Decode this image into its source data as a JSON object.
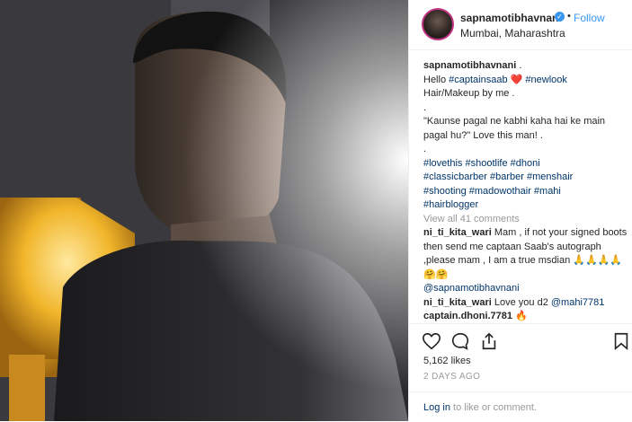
{
  "post": {
    "username": "sapnamotibhavnani",
    "dot": "•",
    "follow_label": "Follow",
    "location": "Mumbai, Maharashtra"
  },
  "caption": {
    "author": "sapnamotibhavnani",
    "author_suffix": " .",
    "line1_prefix": "Hello ",
    "tag_captainsaab": "#captainsaab",
    "heart": "❤️",
    "tag_newlook": "#newlook",
    "line2": "Hair/Makeup by me .",
    "line3": ".",
    "line4": "\"Kaunse pagal ne kabhi kaha hai ke main pagal hu?\" Love this man! .",
    "line5": ".",
    "tags1": "#lovethis #shootlife #dhoni",
    "tags2": "#classicbarber #barber #menshair",
    "tags3": "#shooting #madowothair #mahi",
    "tags4": "#hairblogger"
  },
  "view_all": "View all 41 comments",
  "comments": [
    {
      "user": "ni_ti_kita_wari",
      "text": " Mam , if not your signed boots then send me captaan Saab's autograph ,please mam , I am a true msdian 🙏🙏🙏🙏🤗🤗",
      "mention": "@sapnamotibhavnani"
    },
    {
      "user": "ni_ti_kita_wari",
      "text": " Love you d2 ",
      "mention": "@mahi7781"
    },
    {
      "user": "captain.dhoni.7781",
      "text": " 🔥"
    }
  ],
  "likes": "5,162 likes",
  "date": "2 DAYS AGO",
  "login": {
    "link": "Log in",
    "rest": " to like or comment."
  },
  "icons": {
    "heart": "heart-icon",
    "comment": "comment-icon",
    "share": "share-icon",
    "bookmark": "bookmark-icon",
    "verified": "verified-badge-icon"
  },
  "colors": {
    "link": "#003569",
    "follow": "#3897f0",
    "muted": "#999999",
    "heart": "#ed4956"
  }
}
